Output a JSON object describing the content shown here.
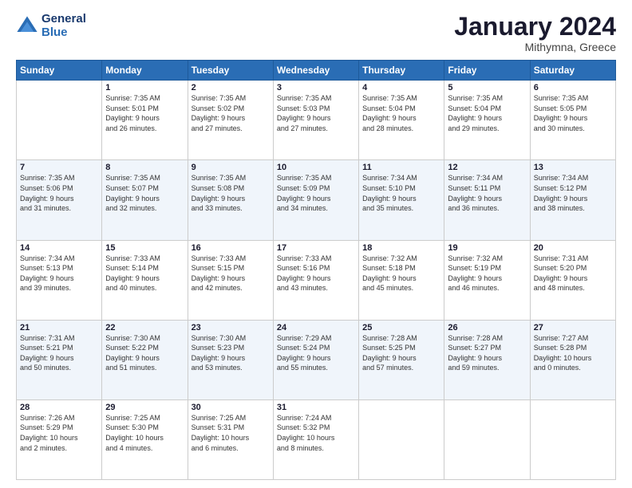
{
  "logo": {
    "line1": "General",
    "line2": "Blue"
  },
  "title": "January 2024",
  "subtitle": "Mithymna, Greece",
  "days_header": [
    "Sunday",
    "Monday",
    "Tuesday",
    "Wednesday",
    "Thursday",
    "Friday",
    "Saturday"
  ],
  "weeks": [
    [
      {
        "num": "",
        "info": ""
      },
      {
        "num": "1",
        "info": "Sunrise: 7:35 AM\nSunset: 5:01 PM\nDaylight: 9 hours\nand 26 minutes."
      },
      {
        "num": "2",
        "info": "Sunrise: 7:35 AM\nSunset: 5:02 PM\nDaylight: 9 hours\nand 27 minutes."
      },
      {
        "num": "3",
        "info": "Sunrise: 7:35 AM\nSunset: 5:03 PM\nDaylight: 9 hours\nand 27 minutes."
      },
      {
        "num": "4",
        "info": "Sunrise: 7:35 AM\nSunset: 5:04 PM\nDaylight: 9 hours\nand 28 minutes."
      },
      {
        "num": "5",
        "info": "Sunrise: 7:35 AM\nSunset: 5:04 PM\nDaylight: 9 hours\nand 29 minutes."
      },
      {
        "num": "6",
        "info": "Sunrise: 7:35 AM\nSunset: 5:05 PM\nDaylight: 9 hours\nand 30 minutes."
      }
    ],
    [
      {
        "num": "7",
        "info": "Sunrise: 7:35 AM\nSunset: 5:06 PM\nDaylight: 9 hours\nand 31 minutes."
      },
      {
        "num": "8",
        "info": "Sunrise: 7:35 AM\nSunset: 5:07 PM\nDaylight: 9 hours\nand 32 minutes."
      },
      {
        "num": "9",
        "info": "Sunrise: 7:35 AM\nSunset: 5:08 PM\nDaylight: 9 hours\nand 33 minutes."
      },
      {
        "num": "10",
        "info": "Sunrise: 7:35 AM\nSunset: 5:09 PM\nDaylight: 9 hours\nand 34 minutes."
      },
      {
        "num": "11",
        "info": "Sunrise: 7:34 AM\nSunset: 5:10 PM\nDaylight: 9 hours\nand 35 minutes."
      },
      {
        "num": "12",
        "info": "Sunrise: 7:34 AM\nSunset: 5:11 PM\nDaylight: 9 hours\nand 36 minutes."
      },
      {
        "num": "13",
        "info": "Sunrise: 7:34 AM\nSunset: 5:12 PM\nDaylight: 9 hours\nand 38 minutes."
      }
    ],
    [
      {
        "num": "14",
        "info": "Sunrise: 7:34 AM\nSunset: 5:13 PM\nDaylight: 9 hours\nand 39 minutes."
      },
      {
        "num": "15",
        "info": "Sunrise: 7:33 AM\nSunset: 5:14 PM\nDaylight: 9 hours\nand 40 minutes."
      },
      {
        "num": "16",
        "info": "Sunrise: 7:33 AM\nSunset: 5:15 PM\nDaylight: 9 hours\nand 42 minutes."
      },
      {
        "num": "17",
        "info": "Sunrise: 7:33 AM\nSunset: 5:16 PM\nDaylight: 9 hours\nand 43 minutes."
      },
      {
        "num": "18",
        "info": "Sunrise: 7:32 AM\nSunset: 5:18 PM\nDaylight: 9 hours\nand 45 minutes."
      },
      {
        "num": "19",
        "info": "Sunrise: 7:32 AM\nSunset: 5:19 PM\nDaylight: 9 hours\nand 46 minutes."
      },
      {
        "num": "20",
        "info": "Sunrise: 7:31 AM\nSunset: 5:20 PM\nDaylight: 9 hours\nand 48 minutes."
      }
    ],
    [
      {
        "num": "21",
        "info": "Sunrise: 7:31 AM\nSunset: 5:21 PM\nDaylight: 9 hours\nand 50 minutes."
      },
      {
        "num": "22",
        "info": "Sunrise: 7:30 AM\nSunset: 5:22 PM\nDaylight: 9 hours\nand 51 minutes."
      },
      {
        "num": "23",
        "info": "Sunrise: 7:30 AM\nSunset: 5:23 PM\nDaylight: 9 hours\nand 53 minutes."
      },
      {
        "num": "24",
        "info": "Sunrise: 7:29 AM\nSunset: 5:24 PM\nDaylight: 9 hours\nand 55 minutes."
      },
      {
        "num": "25",
        "info": "Sunrise: 7:28 AM\nSunset: 5:25 PM\nDaylight: 9 hours\nand 57 minutes."
      },
      {
        "num": "26",
        "info": "Sunrise: 7:28 AM\nSunset: 5:27 PM\nDaylight: 9 hours\nand 59 minutes."
      },
      {
        "num": "27",
        "info": "Sunrise: 7:27 AM\nSunset: 5:28 PM\nDaylight: 10 hours\nand 0 minutes."
      }
    ],
    [
      {
        "num": "28",
        "info": "Sunrise: 7:26 AM\nSunset: 5:29 PM\nDaylight: 10 hours\nand 2 minutes."
      },
      {
        "num": "29",
        "info": "Sunrise: 7:25 AM\nSunset: 5:30 PM\nDaylight: 10 hours\nand 4 minutes."
      },
      {
        "num": "30",
        "info": "Sunrise: 7:25 AM\nSunset: 5:31 PM\nDaylight: 10 hours\nand 6 minutes."
      },
      {
        "num": "31",
        "info": "Sunrise: 7:24 AM\nSunset: 5:32 PM\nDaylight: 10 hours\nand 8 minutes."
      },
      {
        "num": "",
        "info": ""
      },
      {
        "num": "",
        "info": ""
      },
      {
        "num": "",
        "info": ""
      }
    ]
  ]
}
